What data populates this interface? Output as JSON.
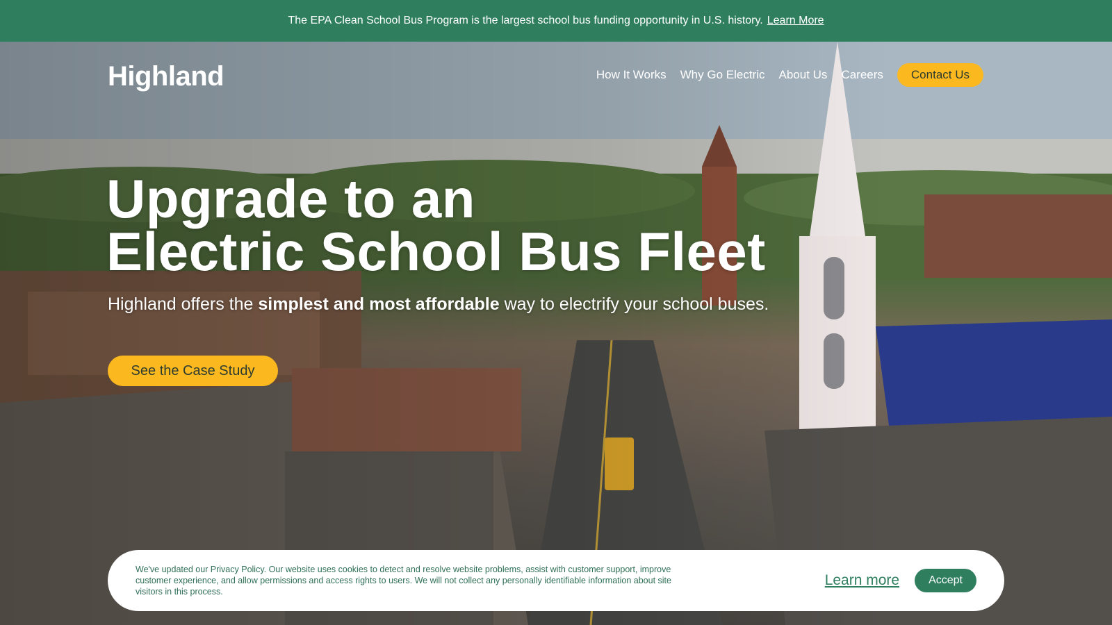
{
  "announcement": {
    "text": "The EPA Clean School Bus Program is the largest school bus funding opportunity in U.S. history.",
    "link_label": "Learn More"
  },
  "header": {
    "logo": "Highland",
    "nav": [
      {
        "label": "How It Works"
      },
      {
        "label": "Why Go Electric"
      },
      {
        "label": "About Us"
      },
      {
        "label": "Careers"
      }
    ],
    "cta_label": "Contact Us"
  },
  "hero": {
    "headline_line1": "Upgrade to an",
    "headline_line2": "Electric School Bus Fleet",
    "sub_before": "Highland offers the ",
    "sub_bold": "simplest and most affordable",
    "sub_after": " way to electrify your school buses.",
    "button_label": "See the Case Study"
  },
  "cookie_banner": {
    "text": "We've updated our Privacy Policy. Our website uses cookies to detect and resolve website problems, assist with customer support, improve customer experience, and allow permissions and access rights to users. We will not collect any personally identifiable information about site visitors in this process.",
    "learn_more_label": "Learn more",
    "accept_label": "Accept"
  },
  "colors": {
    "brand_green": "#2f7f5f",
    "accent_yellow": "#fbb91f",
    "button_text": "#2d3b2f"
  }
}
